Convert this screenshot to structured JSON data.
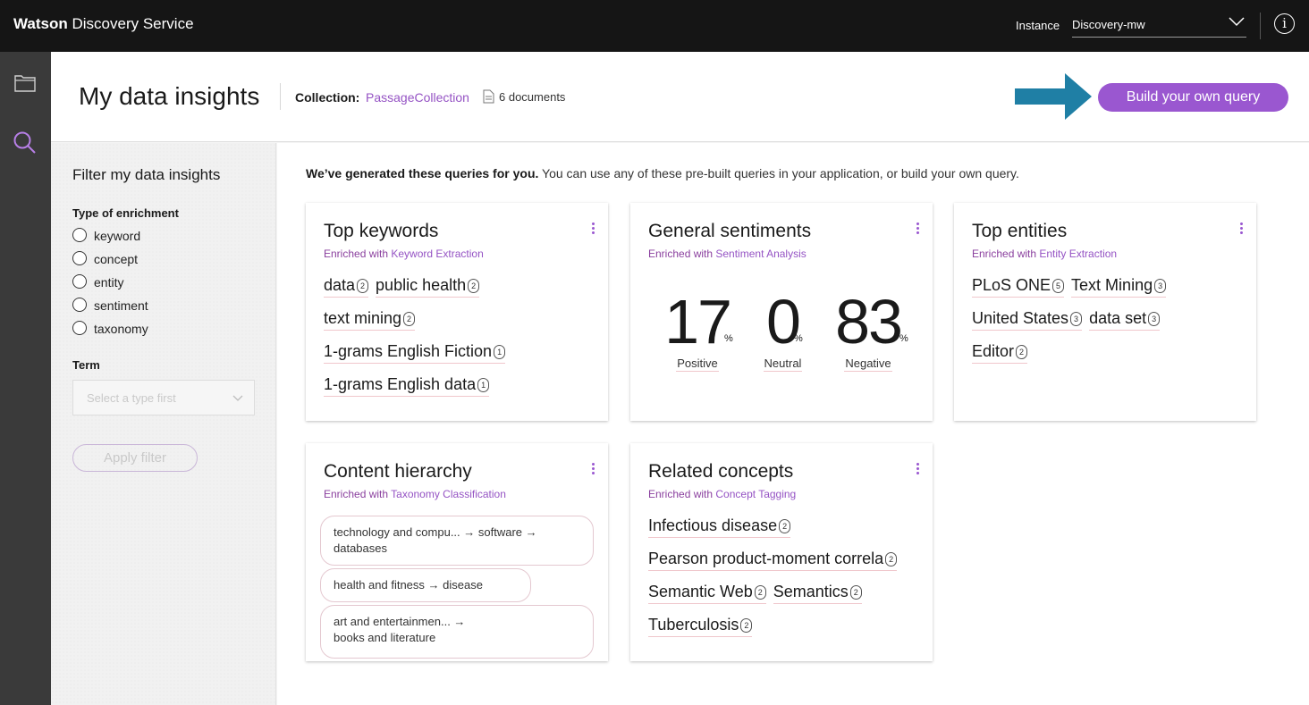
{
  "topbar": {
    "brand_bold": "Watson",
    "brand_rest": " Discovery Service",
    "instance_label": "Instance",
    "instance_value": "Discovery-mw"
  },
  "header": {
    "title": "My data insights",
    "collection_label": "Collection:",
    "collection_name": "PassageCollection",
    "doc_count": "6 documents",
    "build_button": "Build your own query"
  },
  "filter": {
    "title": "Filter my data insights",
    "enrichment_label": "Type of enrichment",
    "enrichments": [
      "keyword",
      "concept",
      "entity",
      "sentiment",
      "taxonomy"
    ],
    "term_label": "Term",
    "term_placeholder": "Select a type first",
    "apply_button": "Apply filter"
  },
  "main": {
    "intro_bold": "We’ve generated these queries for you.",
    "intro_rest": " You can use any of these pre-built queries in your application, or build your own query."
  },
  "cards": {
    "keywords": {
      "title": "Top keywords",
      "sub_pre": "Enriched with ",
      "sub_link": "Keyword Extraction",
      "lines": [
        [
          {
            "t": "data",
            "c": "2"
          },
          {
            "t": "public health",
            "c": "2"
          }
        ],
        [
          {
            "t": "text mining",
            "c": "2"
          }
        ],
        [
          {
            "t": "1-grams English Fiction",
            "c": "1"
          }
        ],
        [
          {
            "t": "1-grams English data",
            "c": "1"
          }
        ]
      ]
    },
    "sentiment": {
      "title": "General sentiments",
      "sub_pre": "Enriched with ",
      "sub_link": "Sentiment Analysis",
      "positive": "17",
      "neutral": "0",
      "negative": "83",
      "pct": "%",
      "positive_label": "Positive",
      "neutral_label": "Neutral",
      "negative_label": "Negative"
    },
    "entities": {
      "title": "Top entities",
      "sub_pre": "Enriched with ",
      "sub_link": "Entity Extraction",
      "lines": [
        [
          {
            "t": "PLoS ONE",
            "c": "5"
          },
          {
            "t": "Text Mining",
            "c": "3"
          }
        ],
        [
          {
            "t": "United States",
            "c": "3"
          },
          {
            "t": "data set",
            "c": "3"
          }
        ],
        [
          {
            "t": "Editor",
            "c": "2"
          }
        ]
      ]
    },
    "hierarchy": {
      "title": "Content hierarchy",
      "sub_pre": "Enriched with ",
      "sub_link": "Taxonomy Classification",
      "items": [
        {
          "line1": "technology and compu...  →  software  →",
          "line2": "databases"
        },
        {
          "line1": "health and fitness  →  disease",
          "line2": ""
        },
        {
          "line1": "art and entertainmen...  →",
          "line2": "books and literature"
        }
      ]
    },
    "concepts": {
      "title": "Related concepts",
      "sub_pre": "Enriched with ",
      "sub_link": "Concept Tagging",
      "lines": [
        [
          {
            "t": "Infectious disease",
            "c": "2"
          }
        ],
        [
          {
            "t": "Pearson product-moment correla",
            "c": "2"
          }
        ],
        [
          {
            "t": "Semantic Web",
            "c": "2"
          },
          {
            "t": "Semantics",
            "c": "2"
          }
        ],
        [
          {
            "t": "Tuberculosis",
            "c": "2"
          }
        ]
      ]
    }
  },
  "colors": {
    "accent": "#9a57d0",
    "topbar": "#151515",
    "rail": "#3a3a3a",
    "arrow": "#1f7fa5"
  }
}
